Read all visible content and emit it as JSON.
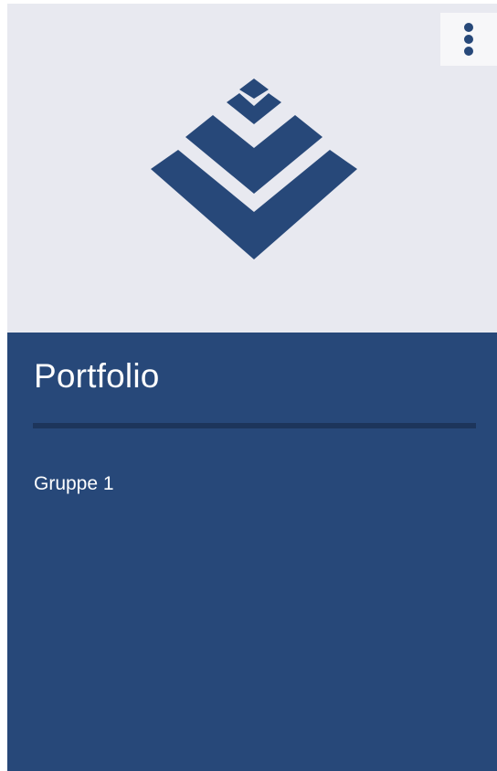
{
  "card": {
    "title": "Portfolio",
    "subtitle": "Gruppe 1",
    "logo_icon": "layered-chevron-logo-icon",
    "menu_icon": "vertical-ellipsis-icon",
    "colors": {
      "header_background": "#e8e9f0",
      "body_background": "#274879",
      "accent": "#274879",
      "divider": "#1d355b",
      "text": "#ffffff"
    }
  }
}
